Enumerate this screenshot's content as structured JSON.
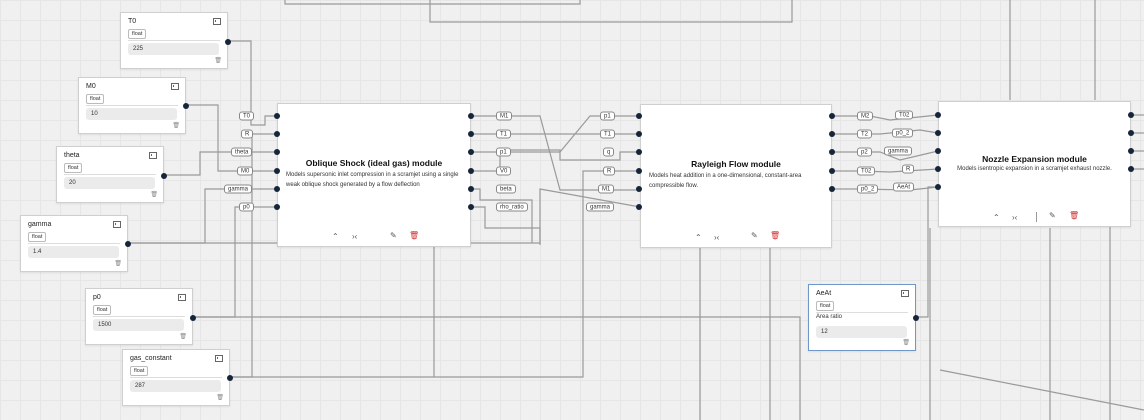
{
  "input_nodes": {
    "T0": {
      "title": "T0",
      "type": "float",
      "value": "225"
    },
    "M0": {
      "title": "M0",
      "type": "float",
      "value": "10"
    },
    "theta": {
      "title": "theta",
      "type": "float",
      "value": "20"
    },
    "gamma": {
      "title": "gamma",
      "type": "float",
      "value": "1.4"
    },
    "p0": {
      "title": "p0",
      "type": "float",
      "value": "1500"
    },
    "gas_constant": {
      "title": "gas_constant",
      "type": "float",
      "value": "287"
    },
    "AeAt": {
      "title": "AeAt",
      "type": "float",
      "label": "Area ratio",
      "value": "12"
    }
  },
  "modules": {
    "oblique": {
      "title": "Oblique Shock (ideal gas) module",
      "description": "Models supersonic inlet compression in a scramjet using a single weak oblique shock generated by a flow deflection",
      "inputs": [
        "T0",
        "R",
        "theta",
        "M0",
        "gamma",
        "p0"
      ],
      "outputs": [
        "M1",
        "T1",
        "p1",
        "V0",
        "beta",
        "rho_ratio"
      ]
    },
    "rayleigh": {
      "title": "Rayleigh Flow module",
      "description": "Models heat addition in a one-dimensional, constant-area compressible flow.",
      "inputs": [
        "p1",
        "T1",
        "q",
        "R",
        "M1",
        "gamma"
      ],
      "outputs": [
        "M2",
        "T2",
        "p2",
        "T02",
        "p0_2"
      ]
    },
    "nozzle": {
      "title": "Nozzle Expansion module",
      "description": "Models isentropic expansion in a scramjet exhaust nozzle.",
      "inputs": [
        "T02",
        "p0_2",
        "gamma",
        "R",
        "AeAt"
      ]
    }
  },
  "icons": {
    "collapse": "collapse-icon",
    "trash": "trash-icon",
    "chevron_up": "chevron-up-icon",
    "compress": "compress-icon",
    "edit": "pencil-icon",
    "delete": "delete-icon"
  },
  "colors": {
    "port": "#15253a",
    "wire": "#9a9a9a",
    "delete": "#d03030",
    "selected_border": "#6f97c9"
  }
}
